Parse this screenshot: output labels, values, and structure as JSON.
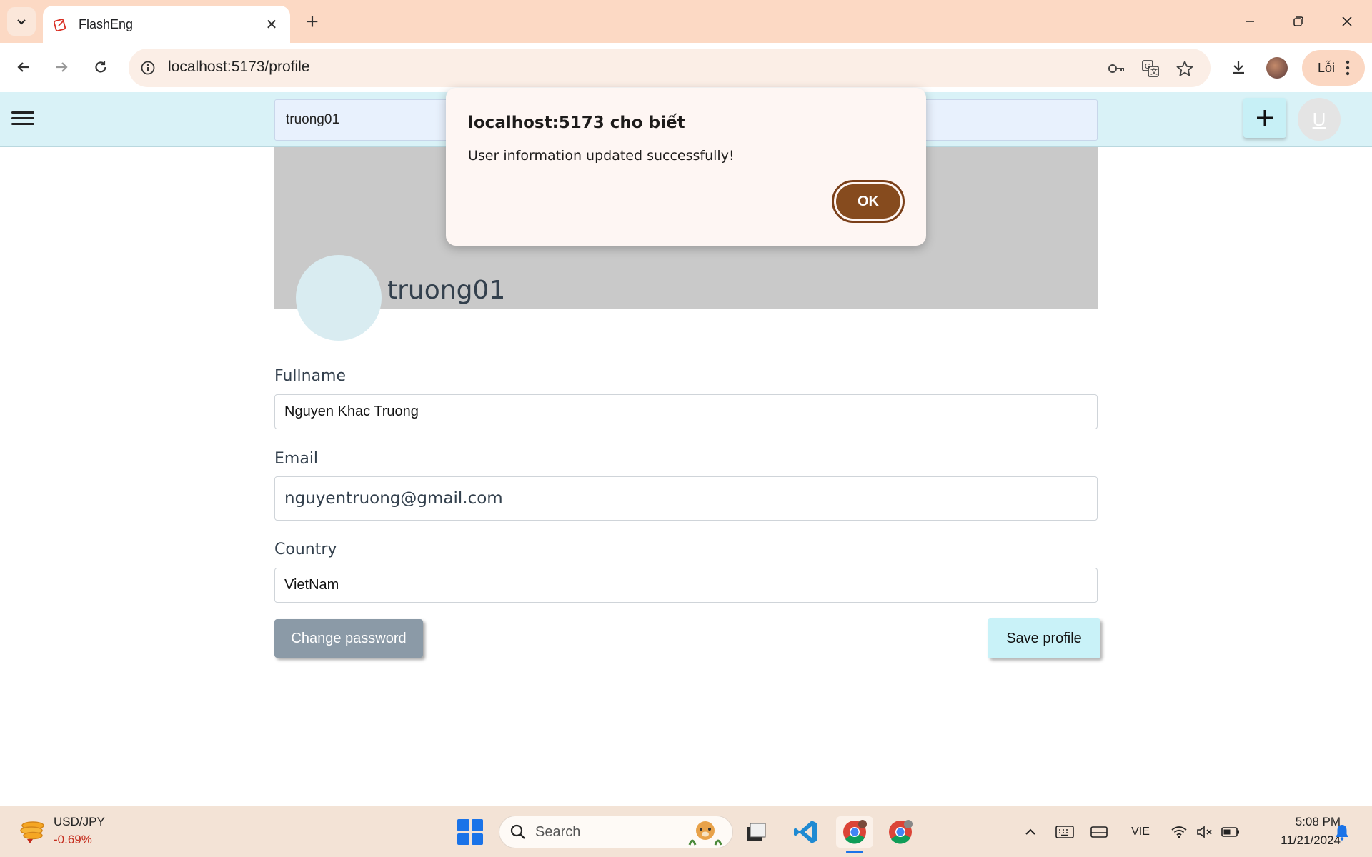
{
  "browser": {
    "tab_title": "FlashEng",
    "url": "localhost:5173/profile",
    "profile_button_label": "Lỗi"
  },
  "app": {
    "search_value": "truong01",
    "user_avatar_initial": "U"
  },
  "profile": {
    "username": "truong01",
    "fullname_label": "Fullname",
    "fullname_value": "Nguyen Khac Truong",
    "email_label": "Email",
    "email_value": "nguyentruong@gmail.com",
    "country_label": "Country",
    "country_value": "VietNam",
    "change_password_label": "Change password",
    "save_profile_label": "Save profile"
  },
  "dialog": {
    "title": "localhost:5173 cho biết",
    "message": "User information updated successfully!",
    "ok_label": "OK"
  },
  "taskbar": {
    "ticker_name": "USD/JPY",
    "ticker_change": "-0.69%",
    "search_placeholder": "Search",
    "language": "VIE",
    "time": "5:08 PM",
    "date": "11/21/2024"
  },
  "colors": {
    "tabbar_bg": "#fcd9c4",
    "app_header_bg": "#d9f2f7",
    "dialog_ok_bg": "#864b1e",
    "save_button_bg": "#c9f2f8",
    "change_password_bg": "#8b9aa7",
    "ticker_negative": "#c42b1c"
  }
}
